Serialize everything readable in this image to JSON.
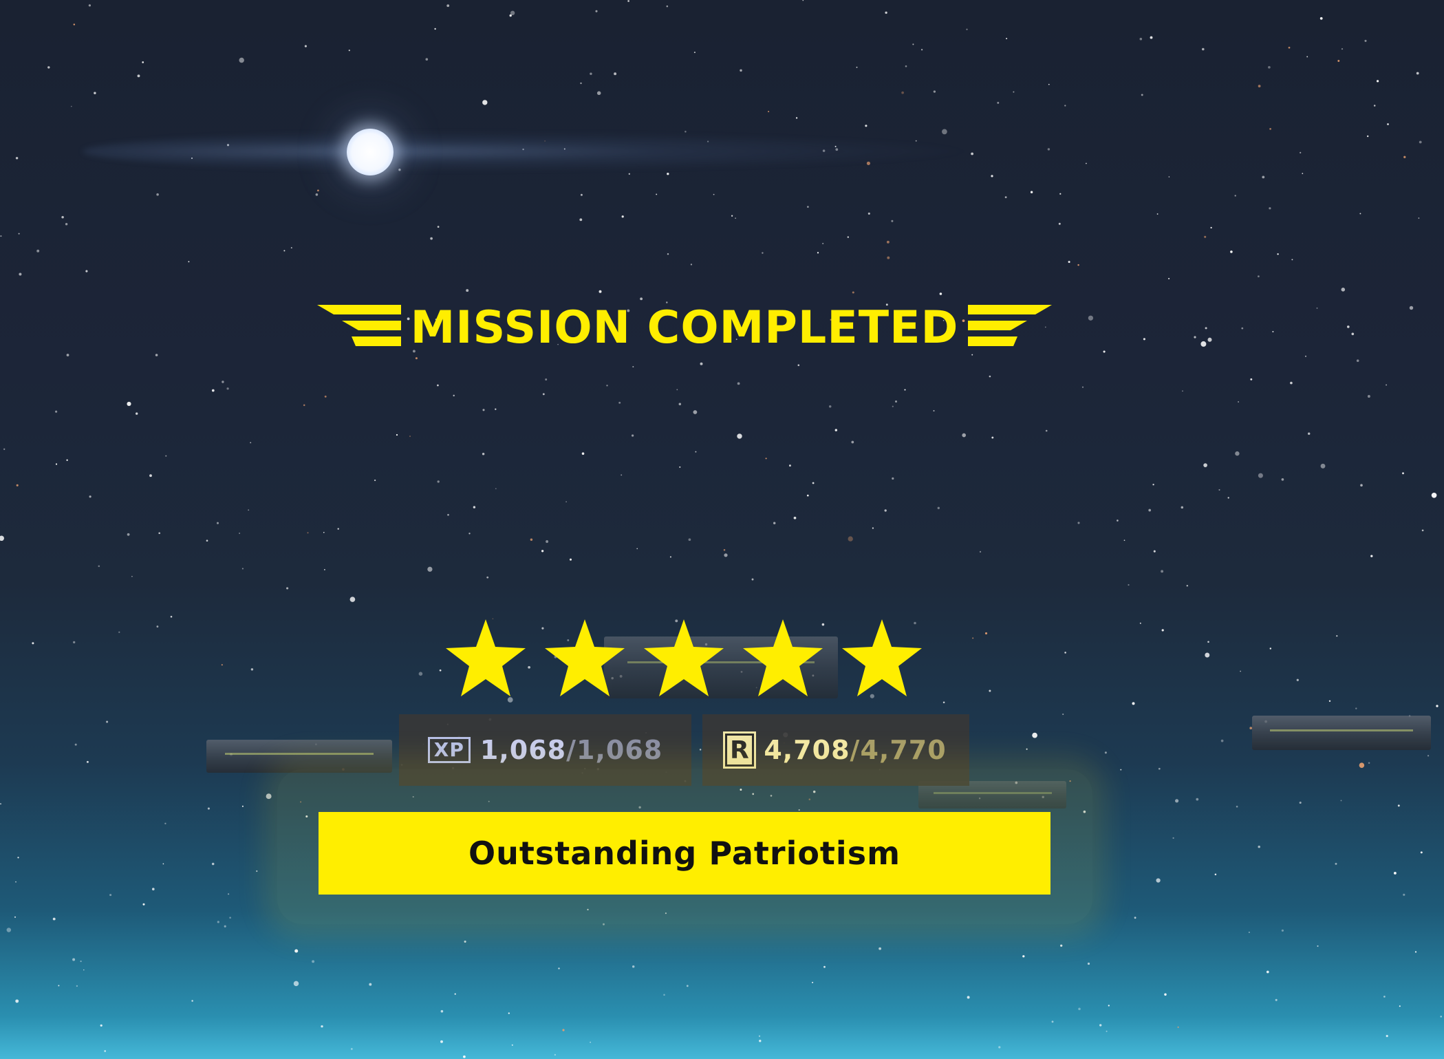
{
  "mission": {
    "title": "MISSION COMPLETED",
    "star_rating": 5,
    "star_rating_max": 5,
    "title_color": "#ffee00",
    "accent_color": "#ffee00"
  },
  "rewards": {
    "xp": {
      "icon": "XP",
      "current": "1,068",
      "separator": "/",
      "max": "1,068"
    },
    "requisition": {
      "icon": "R",
      "current": "4,708",
      "separator": "/",
      "max": "4,770"
    }
  },
  "commendation": {
    "label": "Outstanding Patriotism"
  }
}
